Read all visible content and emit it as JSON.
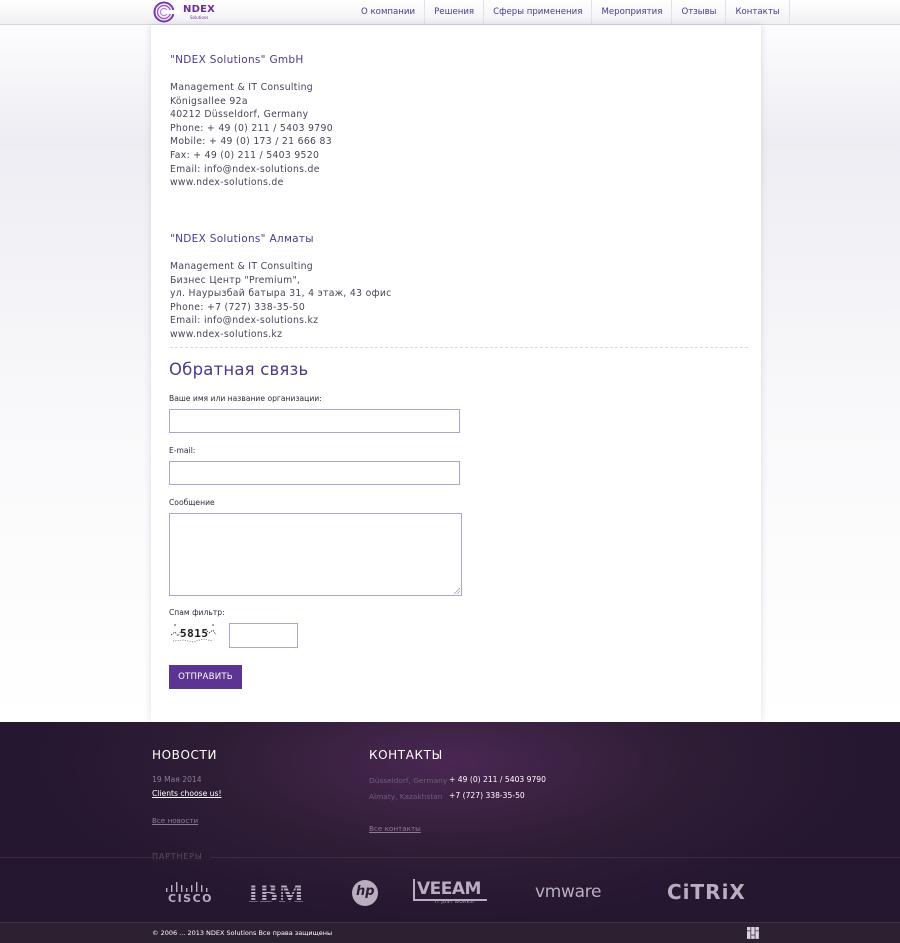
{
  "header": {
    "logo_text": "NDEX",
    "logo_sub": "Solutions",
    "nav": [
      "О компании",
      "Решения",
      "Сферы применения",
      "Мероприятия",
      "Отзывы",
      "Контакты"
    ]
  },
  "offices": [
    {
      "title": "\"NDEX Solutions\" GmbH",
      "lines": [
        "Management & IT Consulting",
        "Königsallee 92a",
        "40212 Düsseldorf, Germany",
        "Phone: + 49 (0) 211 / 5403 9790",
        "Mobile: + 49 (0) 173 / 21 666 83",
        "Fax: + 49 (0) 211 / 5403 9520",
        "Email: info@ndex-solutions.de",
        "www.ndex-solutions.de"
      ]
    },
    {
      "title": "\"NDEX Solutions\" Алматы",
      "lines": [
        "Management & IT Consulting",
        "Бизнес Центр \"Premium\",",
        "ул. Наурызбай батыра 31, 4 этаж, 43 офис",
        "Phone: +7 (727) 338-35-50",
        "Email: info@ndex-solutions.kz",
        "www.ndex-solutions.kz"
      ]
    }
  ],
  "form": {
    "heading": "Обратная связь",
    "name_label": "Ваше имя или название организации:",
    "name_value": "",
    "email_label": "E-mail:",
    "email_value": "",
    "message_label": "Сообщение",
    "message_value": "",
    "spam_label": "Спам фильтр:",
    "captcha": "5815",
    "captcha_value": "",
    "submit": "ОТПРАВИТЬ"
  },
  "footer": {
    "news_heading": "НОВОСТИ",
    "news_date": "19 Мая 2014",
    "news_title": "Clients choose us!",
    "all_news": "Все новости",
    "contacts_heading": "КОНТАКТЫ",
    "contacts": [
      {
        "city": "Düsseldorf, Germany",
        "phone": "+ 49 (0) 211 / 5403 9790"
      },
      {
        "city": "Almaty, Kazakhstan",
        "phone": "+7 (727) 338-35-50"
      }
    ],
    "all_contacts": "Все контакты",
    "partners_label": "ПАРТНЕРЫ",
    "partners": [
      "CISCO",
      "IBM",
      "hp",
      "VEEAM",
      "vmware",
      "CiTRiX"
    ],
    "partner_veeam_tagline": "IT JUST WORKS!",
    "copyright": "© 2006 ... 2013 NDEX Solutions Все права защищены"
  },
  "colors": {
    "accent": "#4b3a8a",
    "button": "#5d3393",
    "footer_bg": "#2f1d36"
  }
}
